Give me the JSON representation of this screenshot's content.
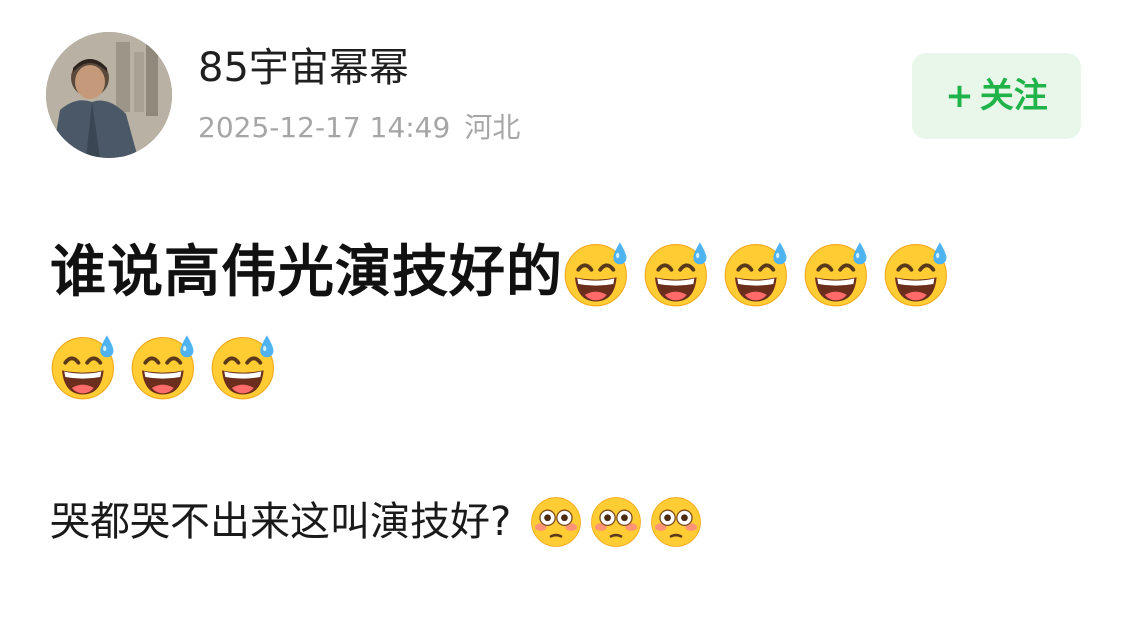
{
  "post": {
    "author": {
      "username": "85宇宙幂幂",
      "avatar_icon": "user-photo-avatar"
    },
    "timestamp": "2025-12-17 14:49",
    "location": "河北",
    "follow_button": {
      "icon": "plus",
      "plus_glyph": "+",
      "label": "关注",
      "color": "#1fb34a",
      "background": "#e9f7ea"
    },
    "content": {
      "line1_text": "谁说高伟光演技好的",
      "line1_emoji": {
        "name": "grinning-sweat-emoji",
        "count": 8
      },
      "line2_text": "哭都哭不出来这叫演技好?",
      "line2_emoji": {
        "name": "flushed-emoji",
        "count": 3
      }
    }
  }
}
